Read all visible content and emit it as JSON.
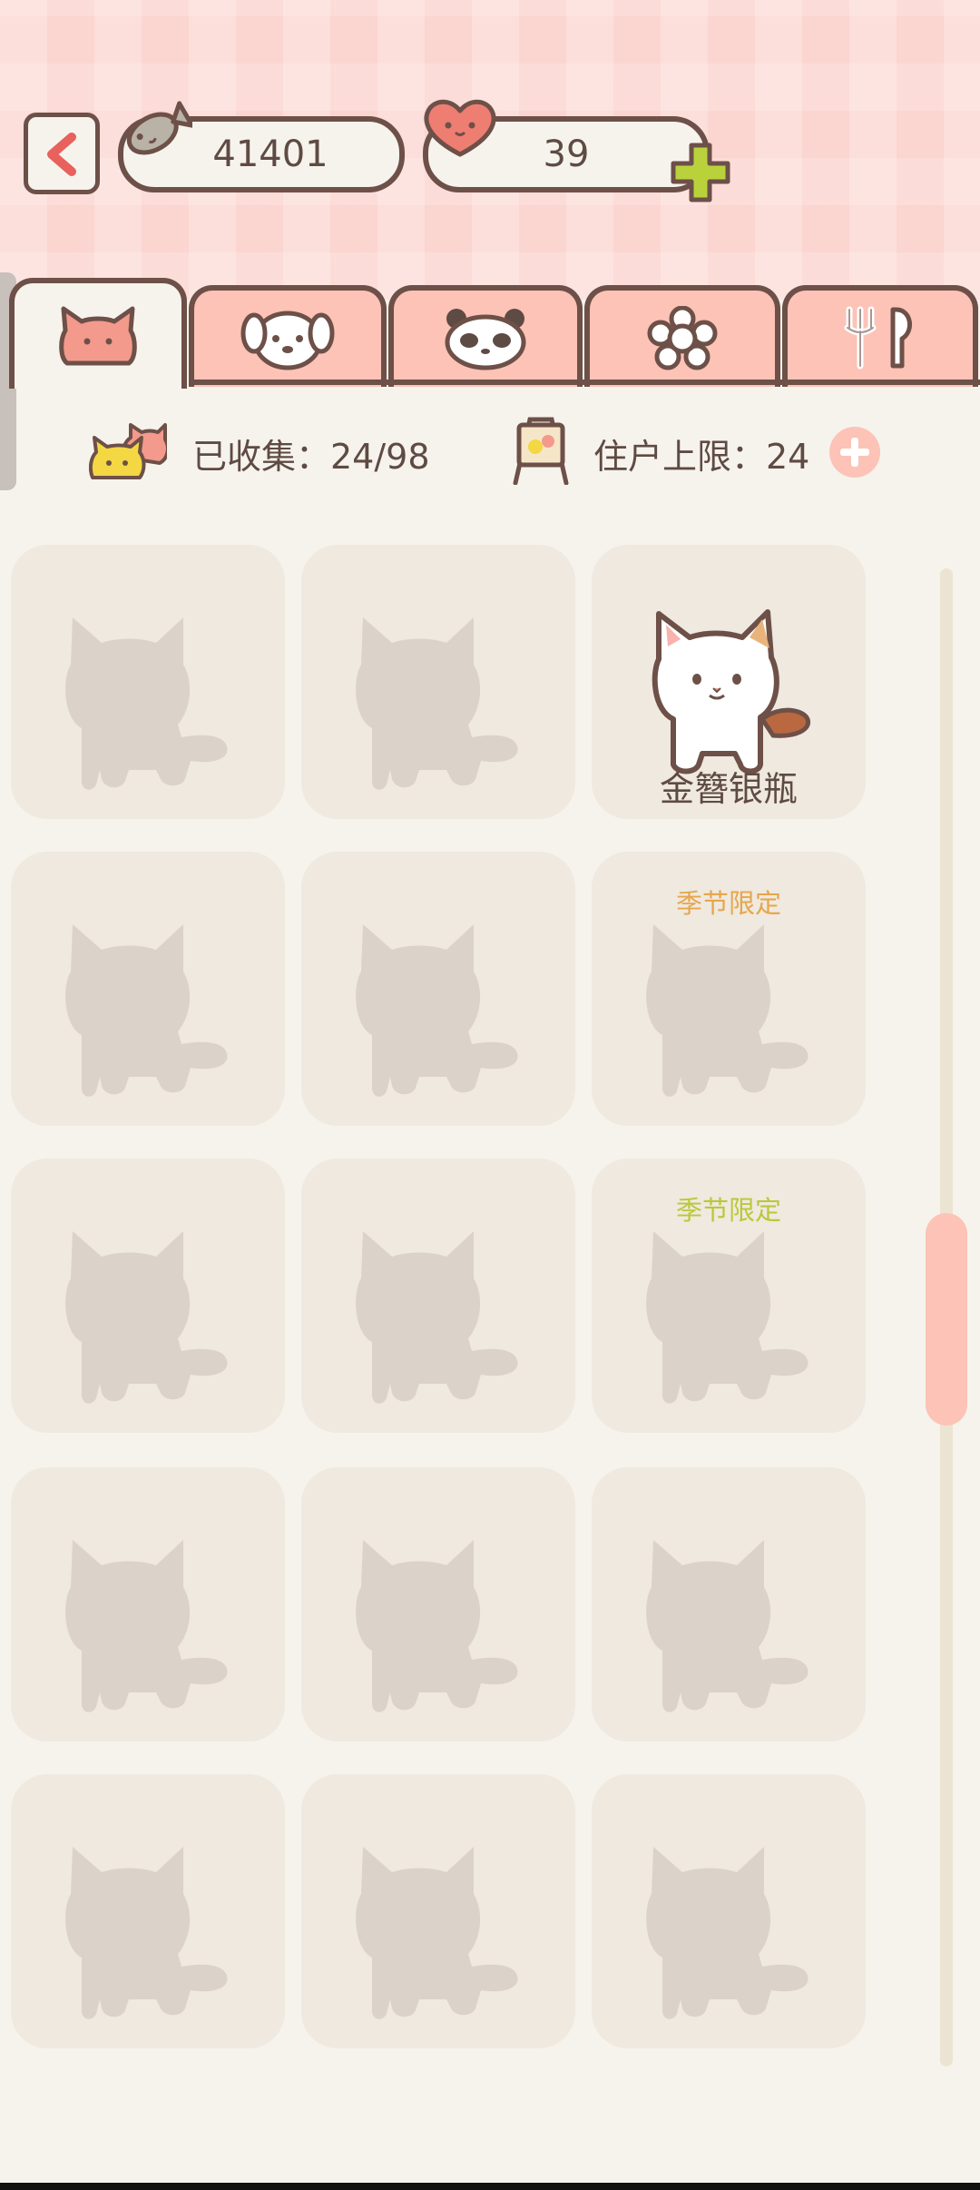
{
  "header": {
    "coins": "41401",
    "hearts": "39"
  },
  "tabs": [
    {
      "name": "cat",
      "icon": "cat-face-icon",
      "active": true
    },
    {
      "name": "dog",
      "icon": "dog-face-icon",
      "active": false
    },
    {
      "name": "panda",
      "icon": "panda-face-icon",
      "active": false
    },
    {
      "name": "flower",
      "icon": "flower-icon",
      "active": false
    },
    {
      "name": "food",
      "icon": "fork-spoon-icon",
      "active": false
    }
  ],
  "stats": {
    "collected_text": "已收集：24/98",
    "resident_limit_text": "住户上限：24"
  },
  "grid": {
    "cards": [
      {
        "unlocked": false
      },
      {
        "unlocked": false
      },
      {
        "unlocked": true,
        "name": "金簪银瓶"
      },
      {
        "unlocked": false
      },
      {
        "unlocked": false
      },
      {
        "unlocked": false,
        "tag": "季节限定",
        "tag_color": "#e7a64c"
      },
      {
        "unlocked": false
      },
      {
        "unlocked": false
      },
      {
        "unlocked": false,
        "tag": "季节限定",
        "tag_color": "#b8c93a"
      },
      {
        "unlocked": false
      },
      {
        "unlocked": false
      },
      {
        "unlocked": false
      },
      {
        "unlocked": false
      },
      {
        "unlocked": false
      },
      {
        "unlocked": false
      }
    ]
  },
  "colors": {
    "accent_pink": "#fcc3b6",
    "outline_brown": "#6d5048",
    "silhouette": "#dbd3c9",
    "plus_green": "#b9d23b"
  }
}
